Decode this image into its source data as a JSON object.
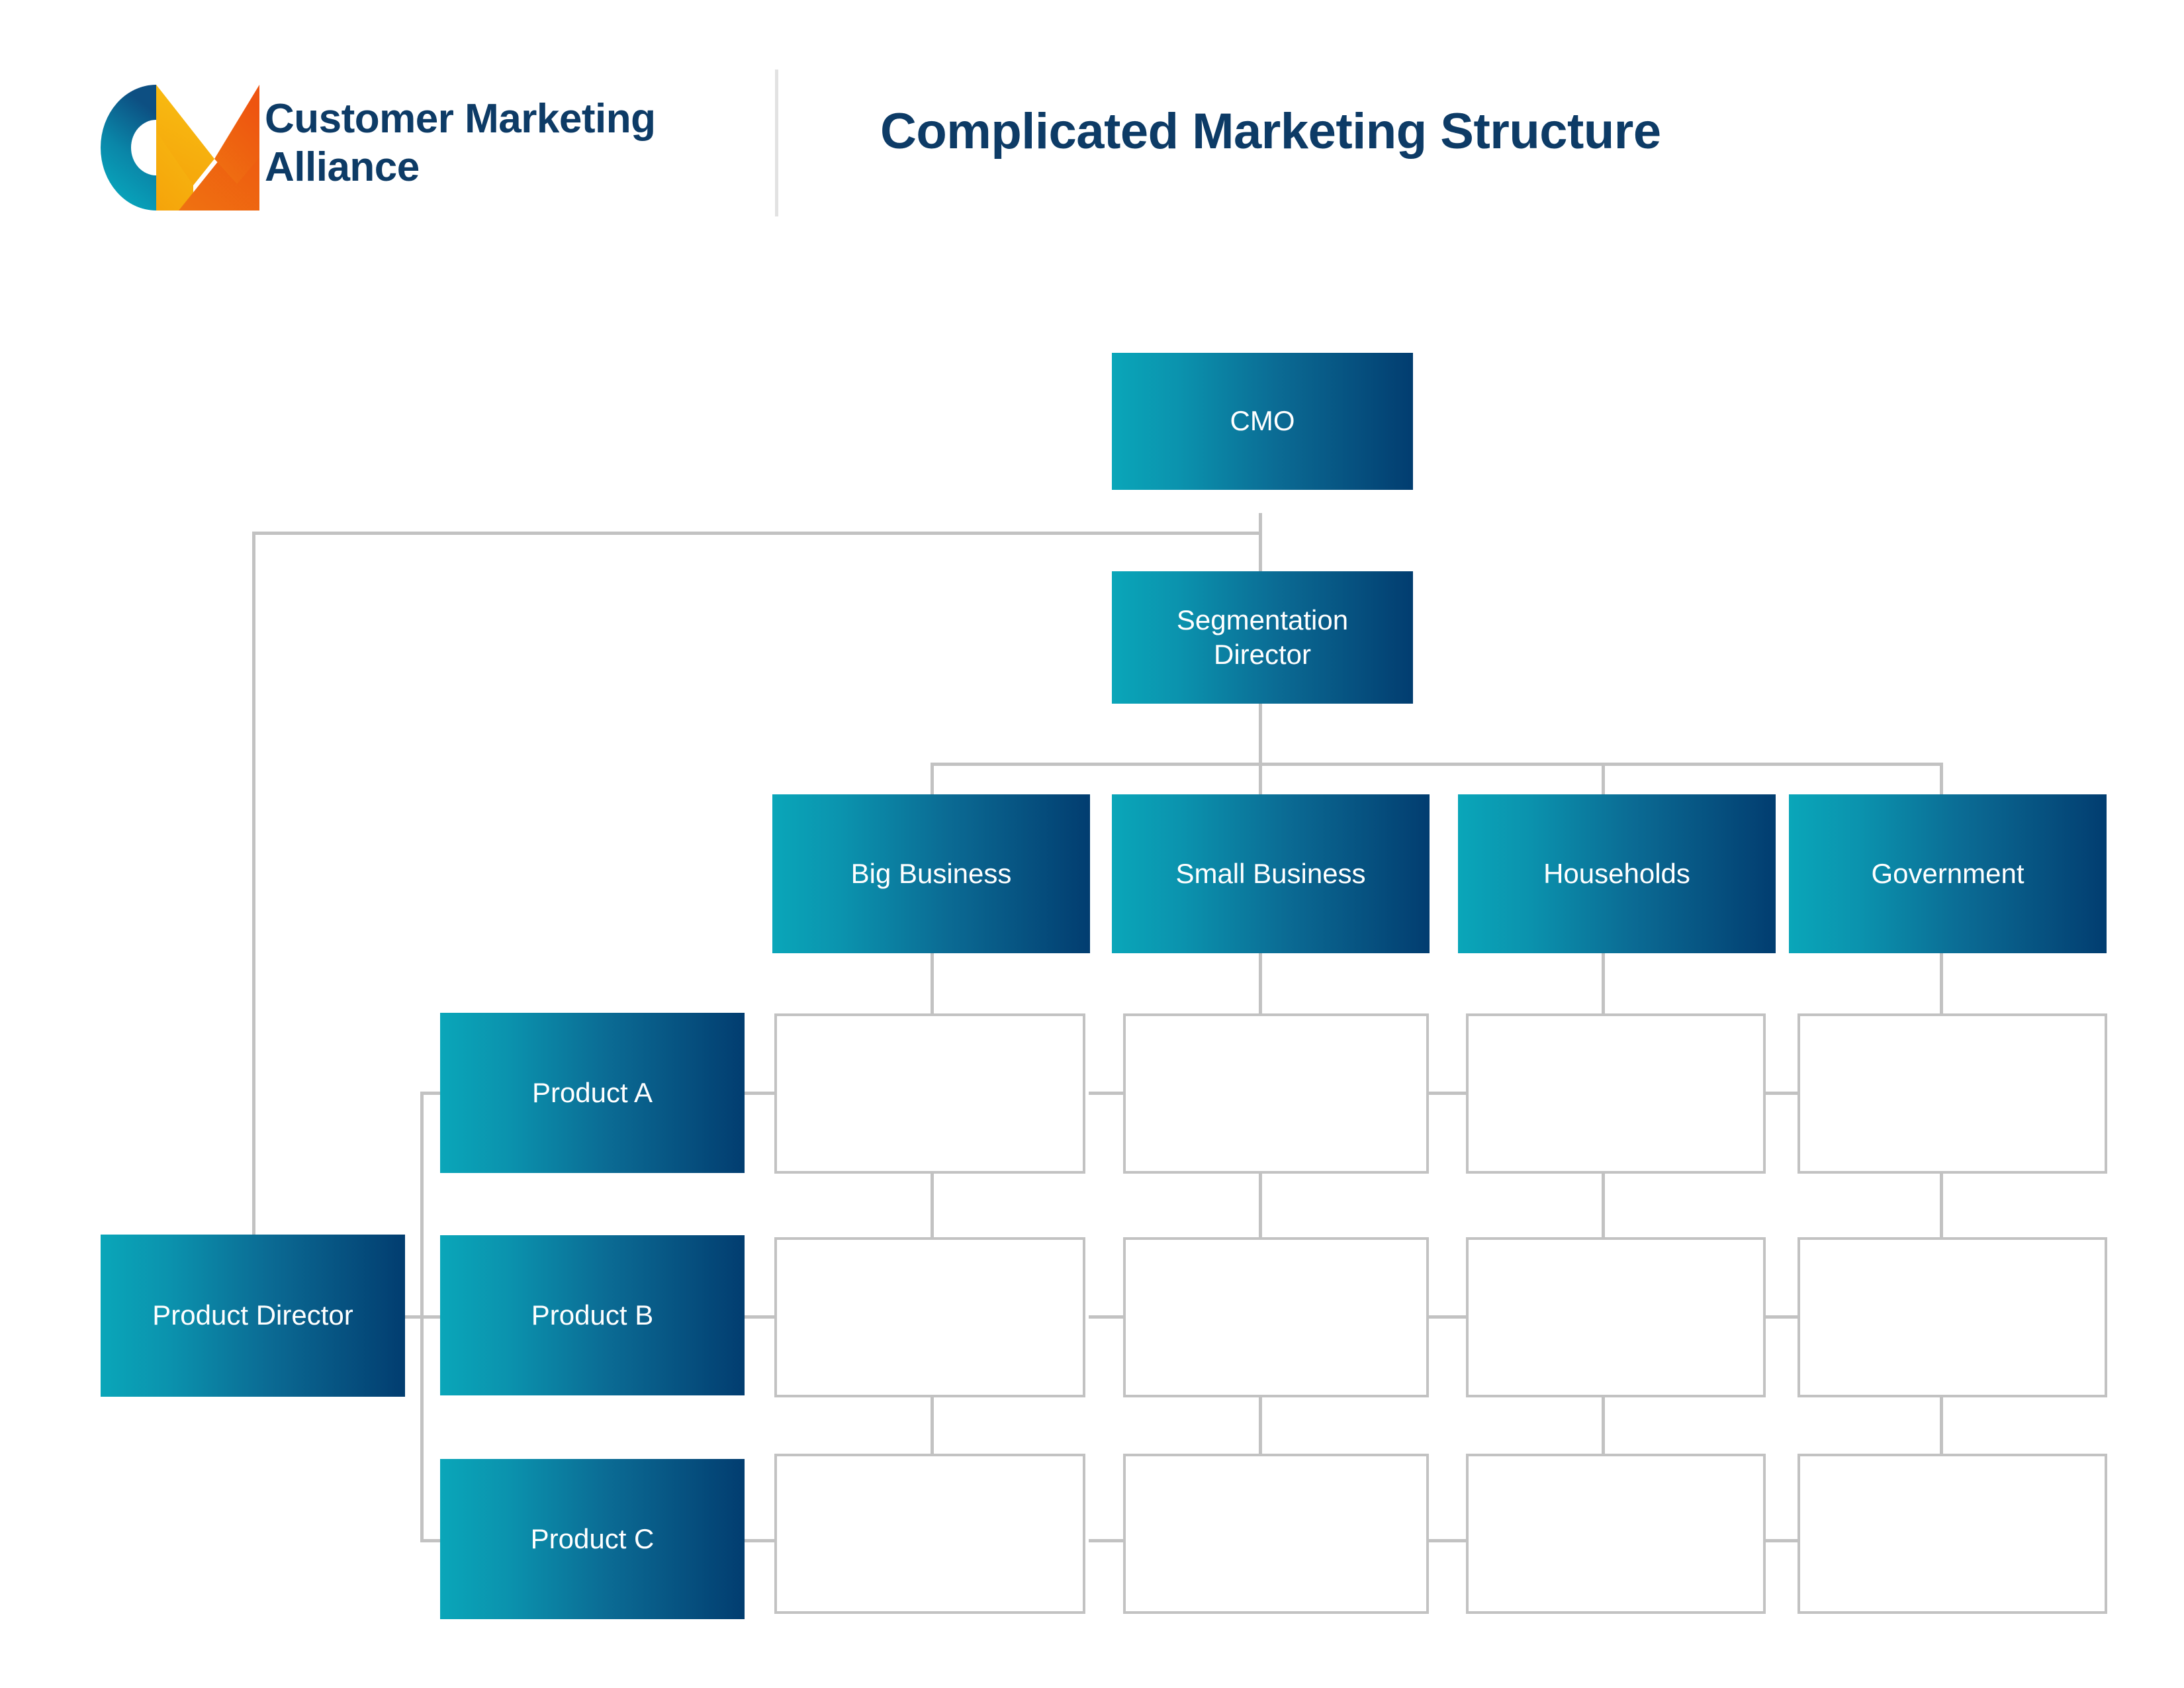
{
  "header": {
    "brand_line1": "Customer Marketing",
    "brand_line2": "Alliance",
    "title": "Complicated Marketing Structure",
    "logo_icon": "cm-monogram-logo",
    "brand_color": "#0d3b66",
    "logo_blue": "#0d4f82",
    "logo_teal": "#0aa6b9",
    "logo_orange": "#ef5f11",
    "logo_yellow": "#f7a80b",
    "divider_color": "#e2e2e2"
  },
  "chart_data": {
    "type": "diagram",
    "diagram_kind": "organization-chart",
    "title": "Complicated Marketing Structure",
    "node_gradient_start": "#0aa6b9",
    "node_gradient_end": "#023d70",
    "node_text_color": "#ffffff",
    "connector_color": "#c2c2c2",
    "empty_cell_border_color": "#c2c2c2",
    "nodes": [
      {
        "id": "cmo",
        "label": "CMO",
        "level": 0
      },
      {
        "id": "seg",
        "label": "Segmentation Director",
        "level": 1
      },
      {
        "id": "pd",
        "label": "Product Director",
        "level": 1
      },
      {
        "id": "s1",
        "label": "Big Business",
        "level": 2
      },
      {
        "id": "s2",
        "label": "Small Business",
        "level": 2
      },
      {
        "id": "s3",
        "label": "Households",
        "level": 2
      },
      {
        "id": "s4",
        "label": "Government",
        "level": 2
      },
      {
        "id": "pa",
        "label": "Product A",
        "level": 2
      },
      {
        "id": "pb",
        "label": "Product B",
        "level": 2
      },
      {
        "id": "pc",
        "label": "Product C",
        "level": 2
      }
    ],
    "edges": [
      {
        "from": "cmo",
        "to": "seg"
      },
      {
        "from": "cmo",
        "to": "pd"
      },
      {
        "from": "seg",
        "to": "s1"
      },
      {
        "from": "seg",
        "to": "s2"
      },
      {
        "from": "seg",
        "to": "s3"
      },
      {
        "from": "seg",
        "to": "s4"
      },
      {
        "from": "pd",
        "to": "pa"
      },
      {
        "from": "pd",
        "to": "pb"
      },
      {
        "from": "pd",
        "to": "pc"
      }
    ],
    "matrix": {
      "description": "Empty intersection cells where each product row crosses each customer segment column",
      "row_labels": [
        "Product A",
        "Product B",
        "Product C"
      ],
      "column_labels": [
        "Big Business",
        "Small Business",
        "Households",
        "Government"
      ],
      "cells": [
        [
          "",
          "",
          "",
          ""
        ],
        [
          "",
          "",
          "",
          ""
        ],
        [
          "",
          "",
          "",
          ""
        ]
      ]
    }
  },
  "nodes": {
    "cmo": "CMO",
    "segmentation_director_l1": "Segmentation",
    "segmentation_director_l2": "Director",
    "product_director": "Product Director",
    "big_business": "Big Business",
    "small_business": "Small Business",
    "households": "Households",
    "government": "Government",
    "product_a": "Product A",
    "product_b": "Product B",
    "product_c": "Product C"
  }
}
